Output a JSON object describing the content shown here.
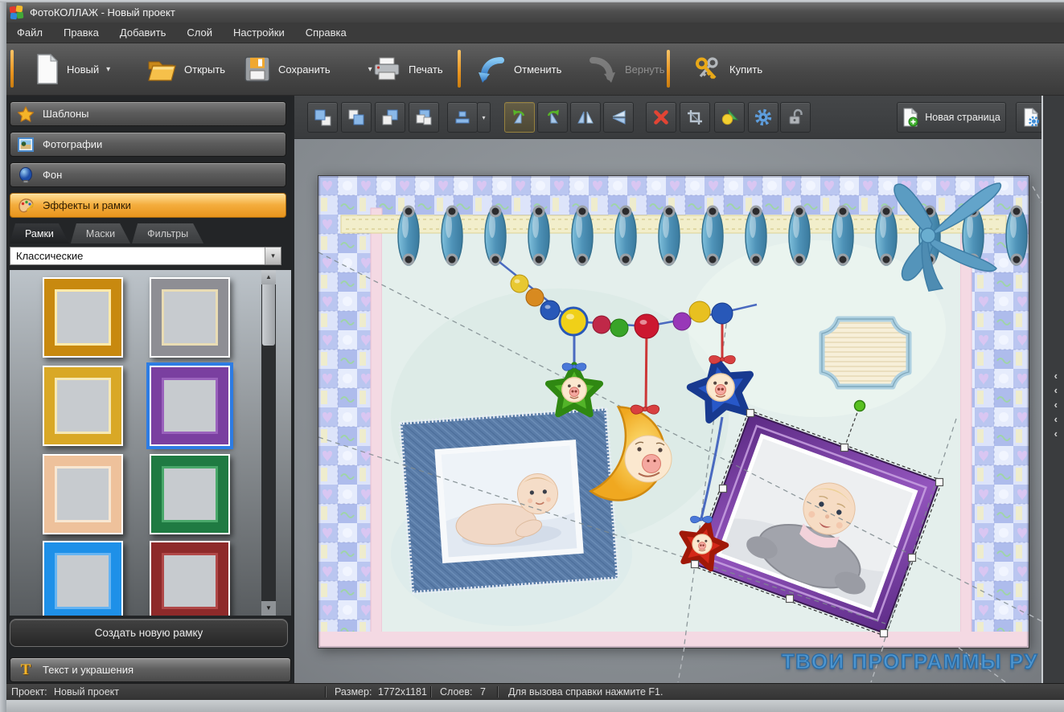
{
  "window": {
    "title": "ФотоКОЛЛАЖ - Новый проект"
  },
  "menubar": {
    "items": [
      {
        "label": "Файл"
      },
      {
        "label": "Правка"
      },
      {
        "label": "Добавить"
      },
      {
        "label": "Слой"
      },
      {
        "label": "Настройки"
      },
      {
        "label": "Справка"
      }
    ]
  },
  "toolbar": {
    "buttons": [
      {
        "id": "new",
        "label": "Новый",
        "dropdown": true,
        "disabled": false
      },
      {
        "id": "open",
        "label": "Открыть",
        "dropdown": false,
        "disabled": false
      },
      {
        "id": "save",
        "label": "Сохранить",
        "dropdown": true,
        "disabled": false
      },
      {
        "id": "print",
        "label": "Печать",
        "dropdown": false,
        "disabled": false
      },
      {
        "id": "undo",
        "label": "Отменить",
        "dropdown": false,
        "disabled": false
      },
      {
        "id": "redo",
        "label": "Вернуть",
        "dropdown": false,
        "disabled": true
      },
      {
        "id": "buy",
        "label": "Купить",
        "dropdown": false,
        "disabled": false
      }
    ]
  },
  "sidebar": {
    "sections": [
      {
        "id": "templates",
        "label": "Шаблоны",
        "active": false
      },
      {
        "id": "photos",
        "label": "Фотографии",
        "active": false
      },
      {
        "id": "background",
        "label": "Фон",
        "active": false
      },
      {
        "id": "effects",
        "label": "Эффекты и рамки",
        "active": true
      }
    ],
    "tabs": [
      {
        "id": "frames",
        "label": "Рамки",
        "active": true
      },
      {
        "id": "masks",
        "label": "Маски",
        "active": false
      },
      {
        "id": "filters",
        "label": "Фильтры",
        "active": false
      }
    ],
    "category_dropdown": {
      "value": "Классические"
    },
    "frame_thumbnails": [
      {
        "name": "gold-glow-frame",
        "color": "#c8890f",
        "inner": "#ffeaa8",
        "selected": false
      },
      {
        "name": "silver-ornate-frame",
        "color": "#8e8e94",
        "inner": "#e9dcb4",
        "selected": false
      },
      {
        "name": "gold-plain-frame",
        "color": "#d9a826",
        "inner": "#f6e8b4",
        "selected": false
      },
      {
        "name": "purple-frame",
        "color": "#7a3fa0",
        "inner": "#9a62bc",
        "selected": true
      },
      {
        "name": "peach-dotted-frame",
        "color": "#eec19b",
        "inner": "#f8e7d2",
        "selected": false
      },
      {
        "name": "green-frame",
        "color": "#1f7a42",
        "inner": "#49a86a",
        "selected": false
      },
      {
        "name": "blue-frame",
        "color": "#1e90e8",
        "inner": "#66b4f2",
        "selected": false
      },
      {
        "name": "dark-red-frame",
        "color": "#8e2a2a",
        "inner": "#b04848",
        "selected": false
      }
    ],
    "create_frame_button": "Создать новую рамку",
    "text_decor_button": "Текст и украшения"
  },
  "canvas_toolbar": {
    "new_page_button": "Новая страница"
  },
  "statusbar": {
    "project_label": "Проект:",
    "project_value": "Новый проект",
    "size_label": "Размер:",
    "size_value": "1772x1181",
    "layers_label": "Слоев:",
    "layers_value": "7",
    "help_text": "Для вызова справки нажмите F1."
  },
  "workspace": {
    "watermark": "ТВОИ ПРОГРАММЫ РУ"
  },
  "glyphs": {
    "caret": "▾",
    "scroll_up": "▲",
    "scroll_down": "▼",
    "chevron": "‹",
    "text_icon": "T"
  },
  "colors": {
    "accent_orange": "#f2a93b",
    "selection_blue": "#2d7ce4",
    "active_tab_bg": "#1f2123",
    "watermark_blue": "#4e96d0"
  }
}
